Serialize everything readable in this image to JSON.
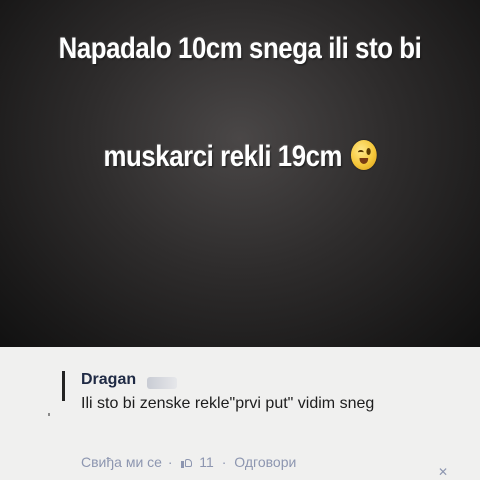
{
  "meme": {
    "line1": "Napadalo 10cm snega ili sto bi",
    "line2": "muskarci rekli 19cm",
    "emoji_icon": "winking-face-icon"
  },
  "comment": {
    "author": "Dragan",
    "text": "Ili sto bi zenske rekle\"prvi put\" vidim sneg",
    "like_label": "Свиђа ми се",
    "separator": "·",
    "like_icon": "thumbs-up-icon",
    "like_count": "11",
    "reply_label": "Одговори"
  },
  "colors": {
    "meme_background": "#2e2c2c",
    "comment_background": "#f0f0ef",
    "author_name": "#1f2a44",
    "action_text": "#8d96b0"
  }
}
